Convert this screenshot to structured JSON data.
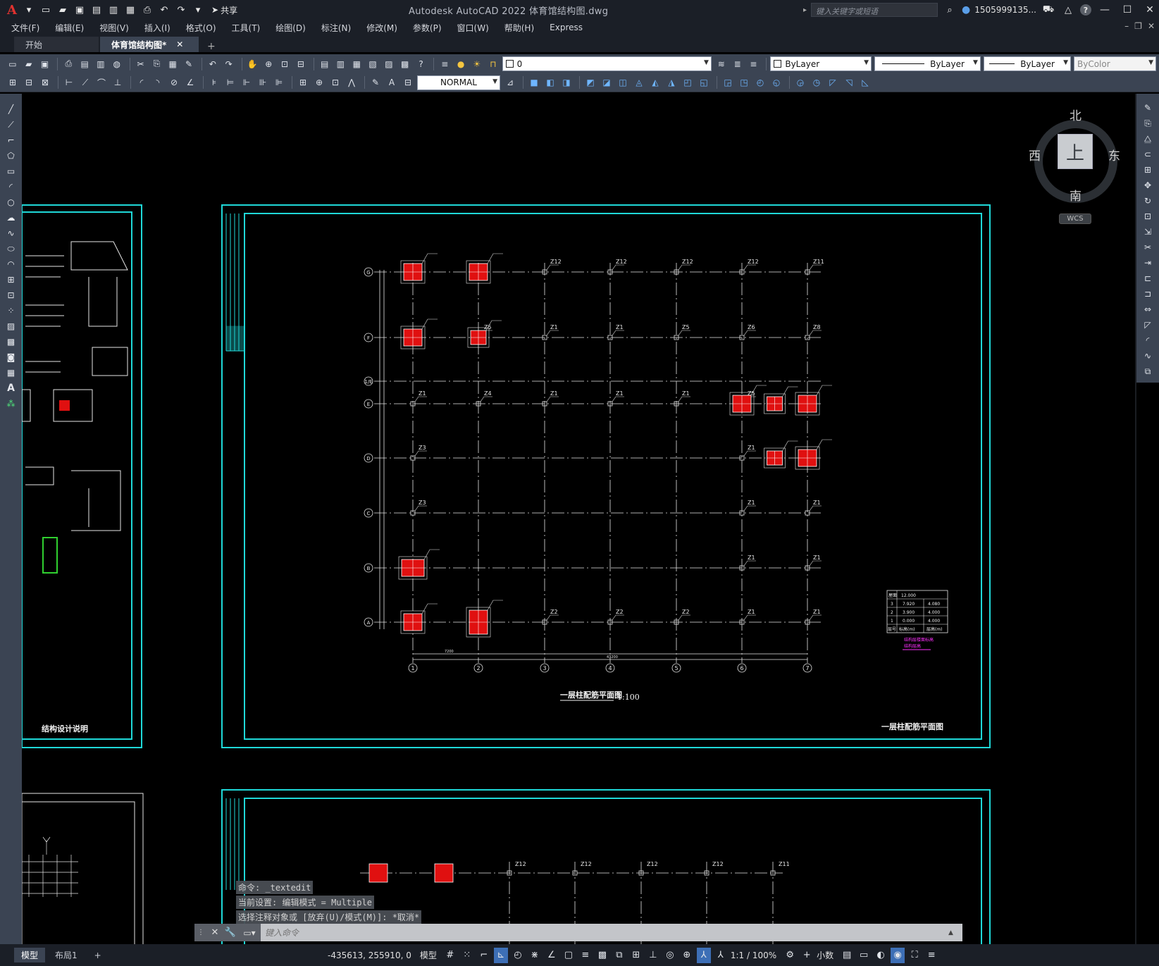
{
  "app": {
    "logo": "A",
    "title": "Autodesk AutoCAD 2022    体育馆结构图.dwg",
    "share_label": "共享",
    "search_placeholder": "键入关键字或短语",
    "user": "1505999135...",
    "help": "?"
  },
  "menu": [
    "文件(F)",
    "编辑(E)",
    "视图(V)",
    "插入(I)",
    "格式(O)",
    "工具(T)",
    "绘图(D)",
    "标注(N)",
    "修改(M)",
    "参数(P)",
    "窗口(W)",
    "帮助(H)",
    "Express"
  ],
  "tabs": [
    {
      "label": "开始",
      "active": false,
      "closable": false
    },
    {
      "label": "体育馆结构图*",
      "active": true,
      "closable": true
    }
  ],
  "properties": {
    "layer": "0",
    "color": "ByLayer",
    "linetype": "ByLayer",
    "lineweight": "ByLayer",
    "plotstyle": "ByColor",
    "dimstyle": "NORMAL"
  },
  "viewcube": {
    "top": "上",
    "north": "北",
    "south": "南",
    "east": "东",
    "west": "西",
    "wcs": "WCS"
  },
  "drawing": {
    "main_title": "一层柱配筋平面图",
    "scale": "1:100",
    "sheet_title": "一层柱配筋平面图",
    "left_sheet_title": "结构设计说明",
    "grid_rows": [
      "G",
      "F",
      "1/E",
      "E",
      "D",
      "C",
      "B",
      "A"
    ],
    "grid_cols": [
      "1",
      "2",
      "3",
      "4",
      "5",
      "6",
      "7"
    ],
    "col_dim": "7200",
    "total_dim": "43200",
    "floor_table": {
      "header": [
        "层号",
        "标高(m)",
        "层高(m)"
      ],
      "roof": [
        "屋面",
        "12.000",
        ""
      ],
      "rows": [
        [
          "3",
          "7.920",
          "4.080"
        ],
        [
          "2",
          "3.900",
          "4.000"
        ],
        [
          "1",
          "0.000",
          "4.000"
        ]
      ],
      "caption1": "结构层楼面标高",
      "caption2": "结构层高"
    },
    "column_labels": [
      "Z1",
      "Z2",
      "Z3",
      "Z4",
      "Z5",
      "Z6",
      "Z8",
      "Z11",
      "Z12"
    ]
  },
  "command": {
    "history": [
      "命令: _textedit",
      "当前设置: 编辑模式 = Multiple",
      "选择注释对象或 [放弃(U)/模式(M)]: *取消*"
    ],
    "placeholder": "键入命令"
  },
  "layout_tabs": [
    {
      "label": "模型",
      "active": true
    },
    {
      "label": "布局1",
      "active": false
    }
  ],
  "status": {
    "coords": "-435613, 255910, 0",
    "space": "模型",
    "annotation_scale": "1:1 / 100%",
    "units": "小数"
  }
}
